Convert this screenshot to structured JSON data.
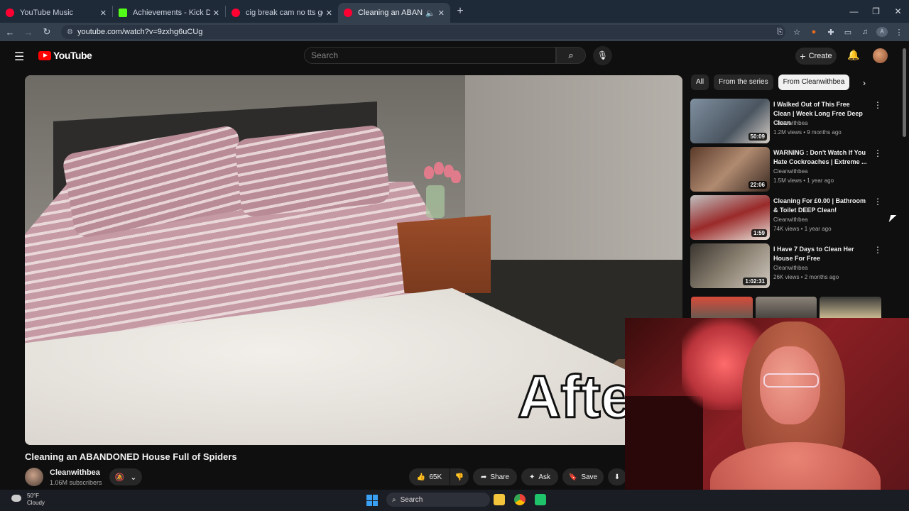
{
  "browser": {
    "tabs": [
      {
        "title": "YouTube Music",
        "favicon_color": "#ff0033",
        "active": false
      },
      {
        "title": "Achievements - Kick Dashboard",
        "favicon_color": "#53fc18",
        "active": false
      },
      {
        "title": "cig break cam no tts getting Ja",
        "favicon_color": "#ff0033",
        "active": false
      },
      {
        "title": "Cleaning an ABANDONED H",
        "favicon_color": "#ff0033",
        "active": true
      }
    ],
    "new_tab": "+",
    "url": "youtube.com/watch?v=9zxhg6uCUg",
    "profile_initial": "A"
  },
  "youtube": {
    "logo_text": "YouTube",
    "search_placeholder": "Search",
    "create_label": "Create"
  },
  "video": {
    "title": "Cleaning an ABANDONED House Full of Spiders",
    "overlay_caption": "Afte",
    "channel_name": "Cleanwithbea",
    "subscribers": "1.06M subscribers",
    "likes": "65K",
    "share_label": "Share",
    "ask_label": "Ask",
    "save_label": "Save"
  },
  "chips": [
    "All",
    "From the series",
    "From Cleanwithbea"
  ],
  "recommendations": [
    {
      "title": "I Walked Out of This Free Clean | Week Long Free Deep Clean",
      "channel": "Cleanwithbea",
      "meta": "1.2M views • 9 months ago",
      "duration": "50:09",
      "thumb_color": "#6a7585"
    },
    {
      "title": "WARNING : Don't Watch If You Hate Cockroaches | Extreme ...",
      "channel": "Cleanwithbea",
      "meta": "1.5M views • 1 year ago",
      "duration": "22:06",
      "thumb_color": "#8a6a55"
    },
    {
      "title": "Cleaning For £0.00 | Bathroom & Toilet DEEP Clean!",
      "channel": "Cleanwithbea",
      "meta": "74K views • 1 year ago",
      "duration": "1:59",
      "thumb_color": "#9a3a3a"
    },
    {
      "title": "I Have 7 Days to Clean Her House For Free",
      "channel": "Cleanwithbea",
      "meta": "26K views • 2 months ago",
      "duration": "1:02:31",
      "thumb_color": "#5a5048"
    }
  ],
  "taskbar": {
    "temperature": "50°F",
    "condition": "Cloudy",
    "search_label": "Search"
  }
}
